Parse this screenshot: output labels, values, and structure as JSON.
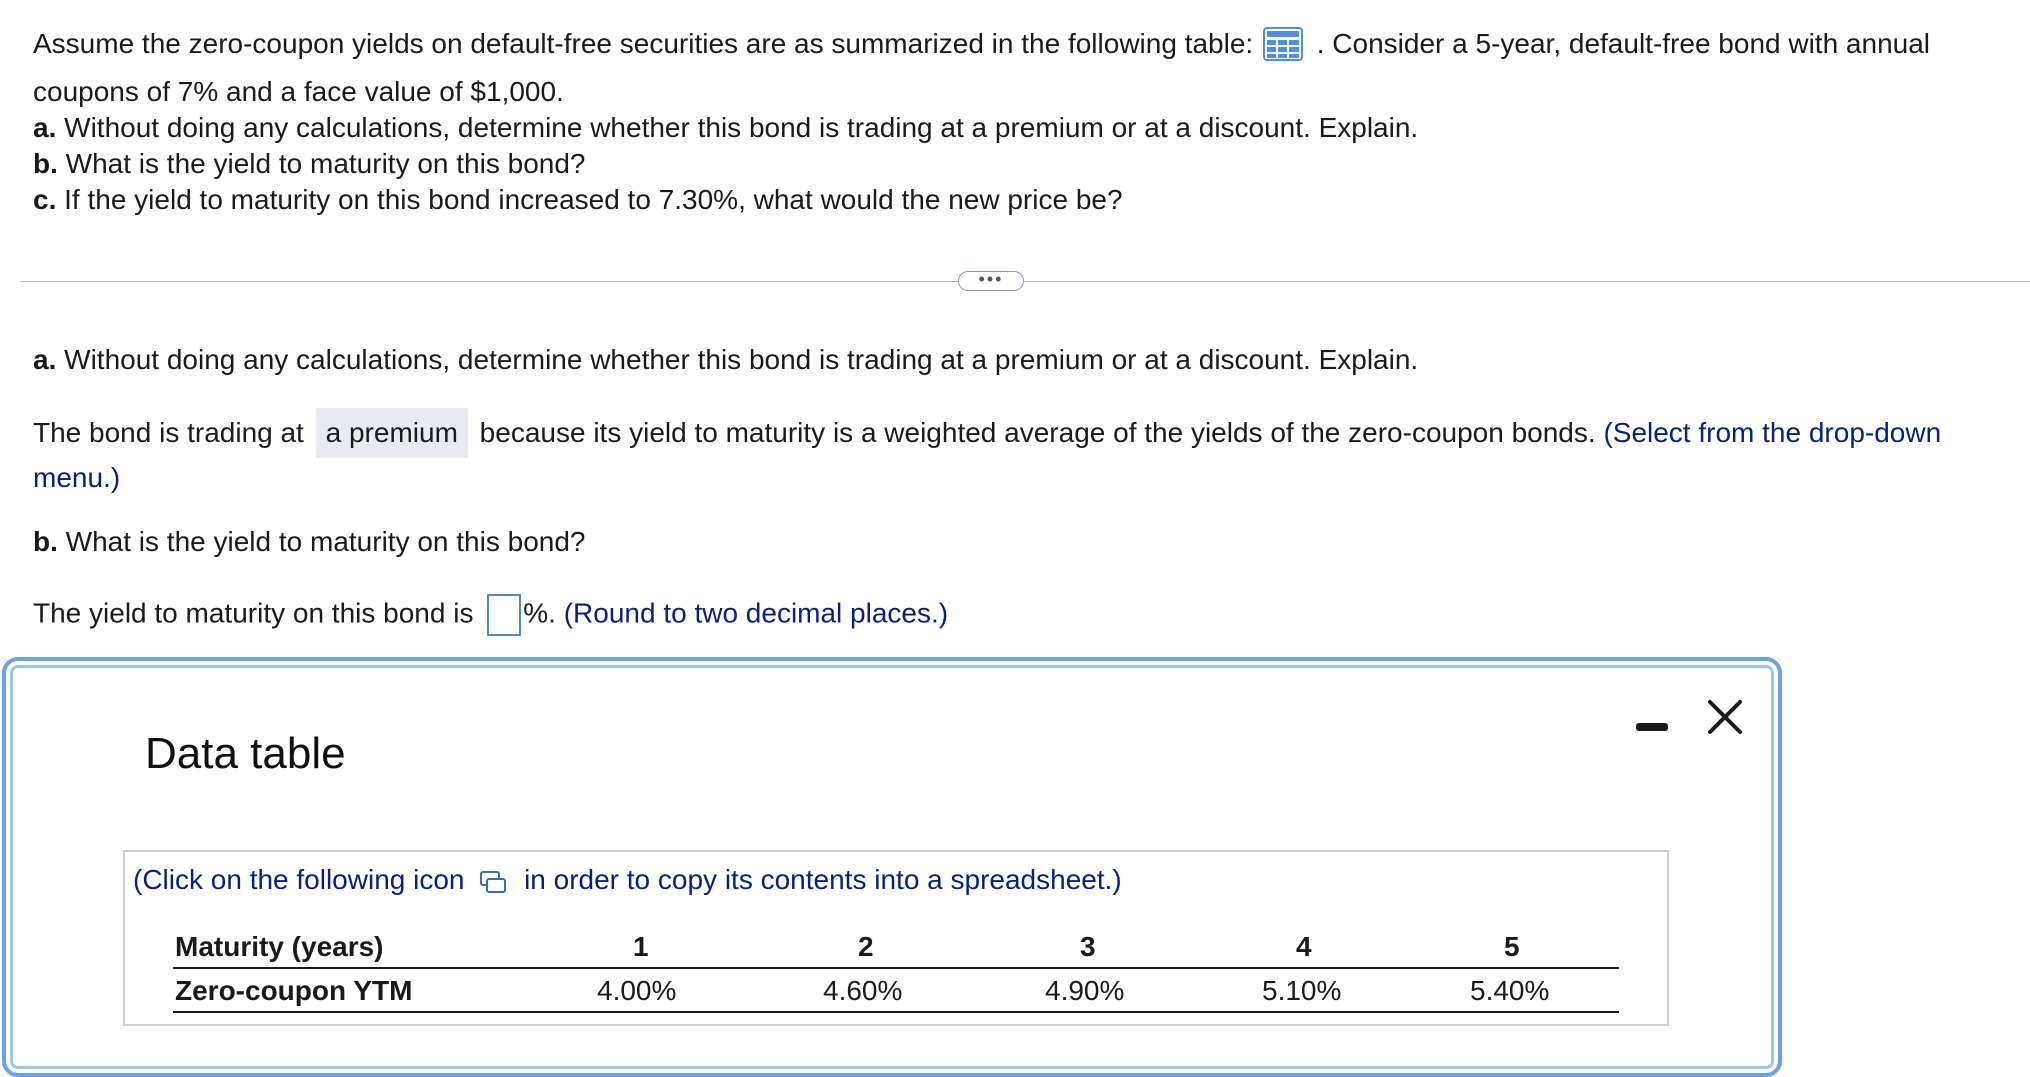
{
  "problem": {
    "intro_line1_before": "Assume the zero-coupon yields on default-free securities are as summarized in the following table:",
    "intro_line1_after": ". Consider a 5-year, default-free bond with annual",
    "intro_line2": "coupons of 7% and a face value of $1,000.",
    "part_a_label": "a.",
    "part_a_text": "Without doing any calculations, determine whether this bond is trading at a premium or at a discount. Explain.",
    "part_b_label": "b.",
    "part_b_text": "What is the yield to maturity on this bond?",
    "part_c_label": "c.",
    "part_c_text": "If the yield to maturity on this bond increased to 7.30%, what would the new price be?"
  },
  "more_button": "•••",
  "answers": {
    "a_label": "a.",
    "a_question": "Without doing any calculations, determine whether this bond is trading at a premium or at a discount. Explain.",
    "a_sentence_before": "The bond is trading at",
    "a_dropdown_value": "a premium",
    "a_sentence_after": "because its yield to maturity is a weighted average of the yields of the zero-coupon bonds.",
    "a_hint_line1": "(Select from the drop-down",
    "a_hint_line2": "menu.)",
    "b_label": "b.",
    "b_question": "What is the yield to maturity on this bond?",
    "b_sentence_before": "The yield to maturity on this bond is",
    "b_input_value": "",
    "b_suffix": "%.",
    "b_hint": "(Round to two decimal places.)"
  },
  "modal": {
    "title": "Data table",
    "copy_note_before": "(Click on the following icon",
    "copy_note_after": "in order to copy its contents into a spreadsheet.)",
    "row_header_maturity": "Maturity (years)",
    "row_header_ytm": "Zero-coupon YTM",
    "maturities": [
      "1",
      "2",
      "3",
      "4",
      "5"
    ],
    "yields": [
      "4.00%",
      "4.60%",
      "4.90%",
      "5.10%",
      "5.40%"
    ]
  },
  "icons": {
    "table": "table-grid-icon",
    "copy": "copy-spreadsheet-icon",
    "minimize": "minimize-icon",
    "close": "close-icon"
  },
  "colors": {
    "hint_text": "#0a1f7a",
    "modal_border": "#6aa3e3",
    "input_border": "#5b85c9",
    "dropdown_bg": "#e8ebf1"
  }
}
